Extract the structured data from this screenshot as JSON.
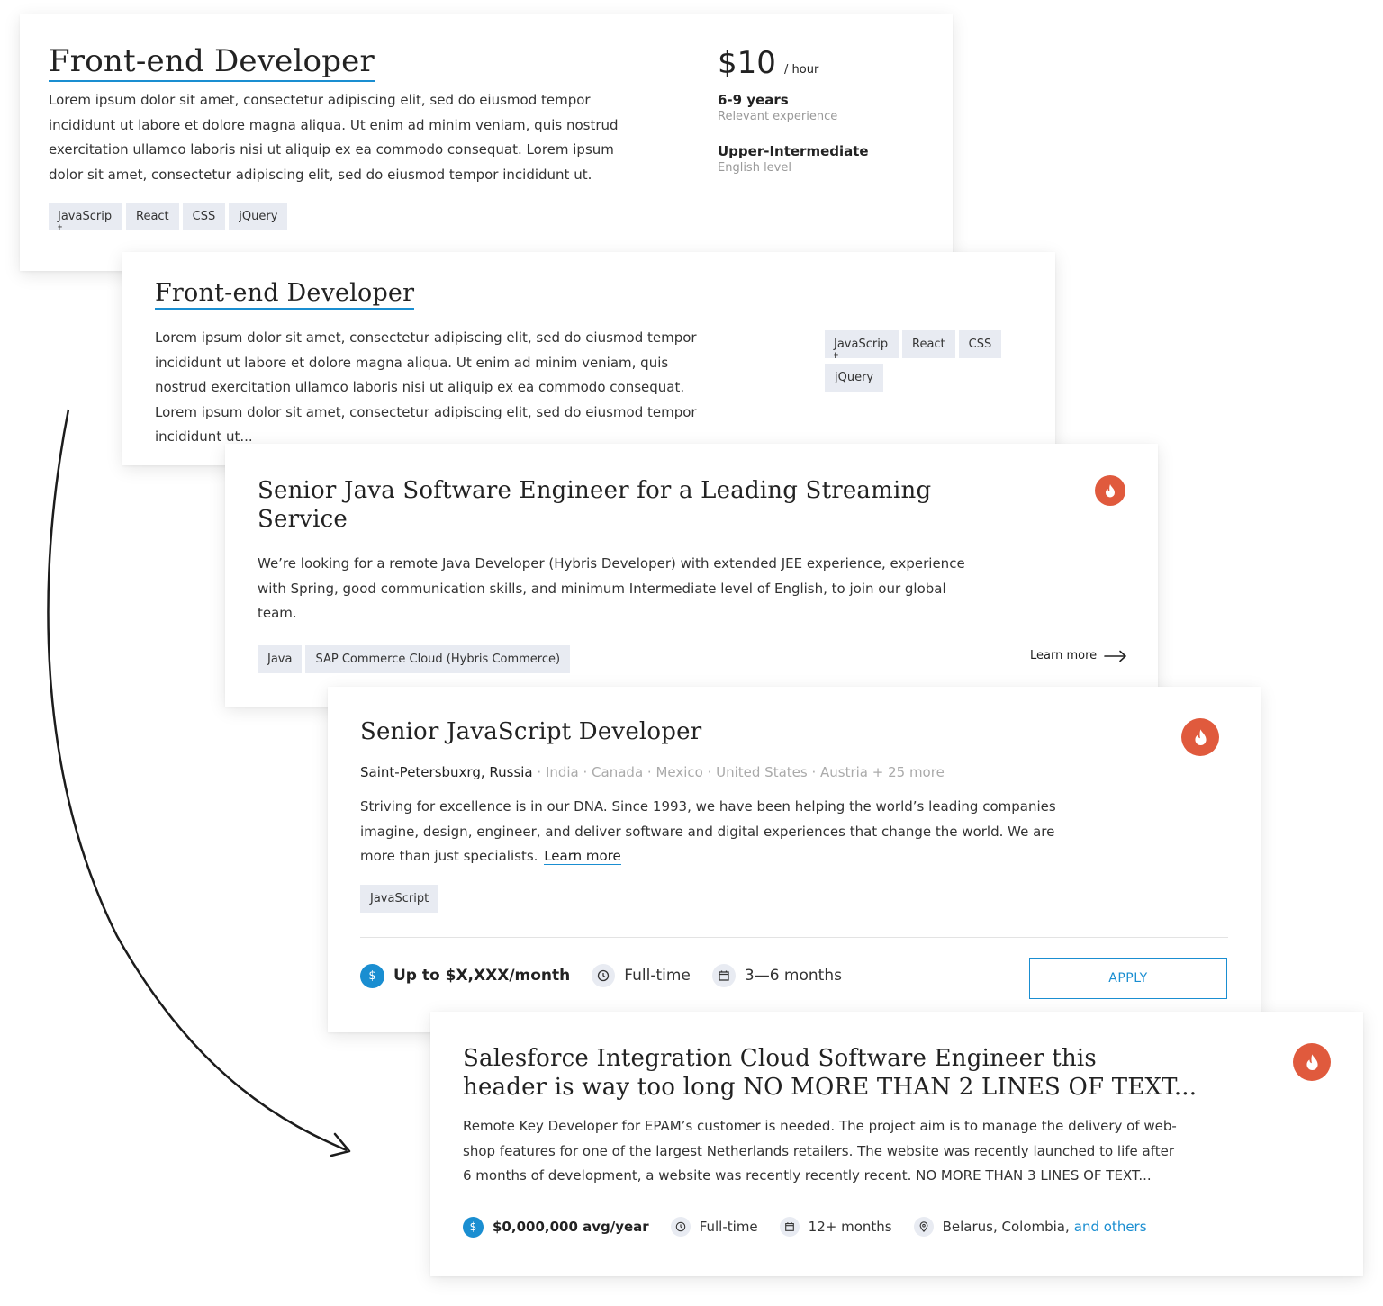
{
  "card1": {
    "title": "Front-end Developer",
    "description": "Lorem ipsum dolor sit amet, consectetur adipiscing elit, sed do eiusmod tempor incididunt ut labore et dolore magna aliqua. Ut enim ad minim veniam, quis nostrud exercitation ullamco laboris nisi ut aliquip ex ea commodo consequat. Lorem ipsum dolor sit amet, consectetur adipiscing elit, sed do eiusmod tempor incididunt ut.",
    "tags": [
      "JavaScript",
      "React",
      "CSS",
      "jQuery"
    ],
    "rate": "$10",
    "rate_unit": "/ hour",
    "experience_value": "6-9 years",
    "experience_label": "Relevant experience",
    "english_value": "Upper-Intermediate",
    "english_label": "English level"
  },
  "card2": {
    "title": "Front-end Developer",
    "description": "Lorem ipsum dolor sit amet, consectetur adipiscing elit, sed do eiusmod tempor incididunt ut labore et dolore magna aliqua. Ut enim ad minim veniam, quis nostrud exercitation ullamco laboris nisi ut aliquip ex ea commodo consequat. Lorem ipsum dolor sit amet, consectetur adipiscing elit, sed do eiusmod tempor incididunt ut...",
    "tags": [
      "JavaScript",
      "React",
      "CSS",
      "jQuery"
    ]
  },
  "card3": {
    "title_line1": "Senior Java Software Engineer for a Leading Streaming",
    "title_line2": "Service",
    "description": "We’re looking for a remote Java Developer (Hybris Developer) with extended JEE experience, experience with Spring, good communication skills, and minimum Intermediate level of English, to join our global team.",
    "tags": [
      "Java",
      "SAP Commerce Cloud (Hybris Commerce)"
    ],
    "learn_more": "Learn more",
    "hot_icon": "fire-icon"
  },
  "card4": {
    "title": "Senior JavaScript Developer",
    "primary_location": "Saint-Petersbuxrg, Russia",
    "other_locations": "· India · Canada · Mexico · United States · Austria + 25 more",
    "description": "Striving for excellence is in our DNA. Since 1993, we have been helping the world’s leading companies imagine, design, engineer, and deliver software and digital experiences that change the world. We are more than just specialists.",
    "learn_more": "Learn more",
    "tags": [
      "JavaScript"
    ],
    "salary": "Up to $X,XXX/month",
    "employment": "Full-time",
    "duration": "3—6 months",
    "apply": "APPLY",
    "hot_icon": "fire-icon"
  },
  "card5": {
    "title_line1": "Salesforce Integration Cloud Software Engineer this",
    "title_line2": "header is way too long NO MORE THAN 2 LINES OF TEXT...",
    "description": "Remote Key Developer for EPAM’s customer is needed. The project aim is to manage the delivery of web-shop features for one of the largest Netherlands retailers. The website was recently launched to life after 6 months of development, a website was recently recently recent. NO MORE THAN 3 LINES OF TEXT...",
    "salary": "$0,000,000 avg/year",
    "employment": "Full-time",
    "duration": "12+ months",
    "locations": "Belarus, Colombia,",
    "locations_more": "and others",
    "hot_icon": "fire-icon"
  },
  "colors": {
    "accent_blue": "#1a8ed1",
    "hot_red": "#e05a3d",
    "tag_bg": "#e8ebf2"
  },
  "icons": {
    "dollar_symbol": "$",
    "arrow": "arrow-right-icon",
    "curved_arrow": "curved-arrow-icon"
  }
}
